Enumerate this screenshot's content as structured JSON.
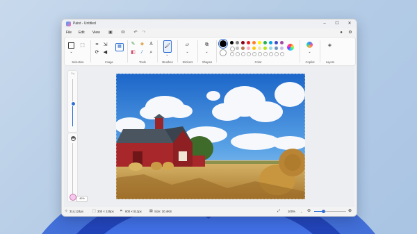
{
  "window": {
    "title": "Paint - Untitled"
  },
  "menu": {
    "items": [
      "File",
      "Edit",
      "View"
    ]
  },
  "ribbon": {
    "groups": {
      "selection": "Selection",
      "image": "Image",
      "tools": "Tools",
      "brushes": "Brushes",
      "stickers": "Stickers",
      "shapes": "Shapes",
      "color": "Color",
      "copilot": "Copilot",
      "layers": "Layers"
    },
    "colors": {
      "selected_primary": "#000000",
      "selected_secondary": "#ffffff",
      "row1": [
        "#000000",
        "#7f7f7f",
        "#880015",
        "#ed1c24",
        "#ff7f27",
        "#fff200",
        "#22b14c",
        "#00a2e8",
        "#3f48cc",
        "#a349a4"
      ],
      "row2": [
        "#ffffff",
        "#c3c3c3",
        "#b97a57",
        "#ffaec9",
        "#ffc90e",
        "#efe4b0",
        "#b5e61d",
        "#99d9ea",
        "#7092be",
        "#c8bfe7"
      ],
      "row3_empty": 10
    }
  },
  "side": {
    "zoom_label": "Sq",
    "zoom_level": 0.5,
    "brush_size_tooltip": "40%",
    "brush_size_level": 0.4
  },
  "status": {
    "cursor": "314,124px",
    "selection": "300 × 125px",
    "canvas_size": "800 × 512px",
    "file_size": "Size: 20.4KB",
    "zoom": "100%",
    "zoom_level": 0.3
  }
}
